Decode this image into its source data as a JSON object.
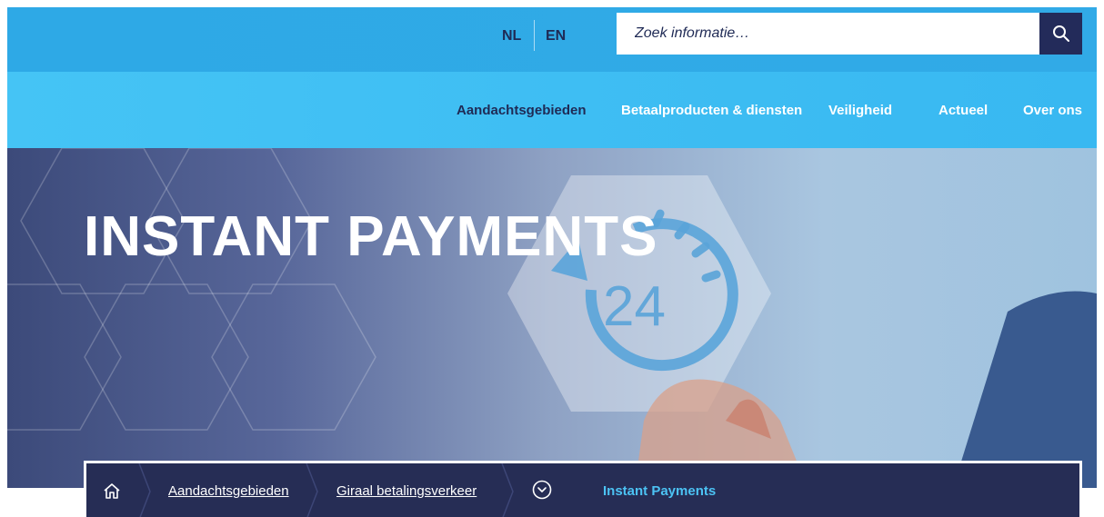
{
  "language": {
    "nl": "NL",
    "en": "EN"
  },
  "search": {
    "placeholder": "Zoek informatie…",
    "icon": "search-icon"
  },
  "nav": {
    "items": [
      {
        "label": "Aandachtsgebieden",
        "active": true
      },
      {
        "label": "Betaalproducten & diensten",
        "active": false
      },
      {
        "label": "Veiligheid",
        "active": false
      },
      {
        "label": "Actueel",
        "active": false
      },
      {
        "label": "Over ons",
        "active": false
      }
    ]
  },
  "hero": {
    "title": "INSTANT PAYMENTS",
    "badge_number": "24"
  },
  "breadcrumb": {
    "home_icon": "home-icon",
    "items": [
      "Aandachtsgebieden",
      "Giraal betalingsverkeer"
    ],
    "toggle_icon": "chevron-down-circle-icon",
    "current": "Instant Payments"
  },
  "colors": {
    "topbar": "#2ea9e6",
    "navbar": "#40c0f4",
    "navy": "#232b5a",
    "current_crumb": "#4cc3f4"
  }
}
